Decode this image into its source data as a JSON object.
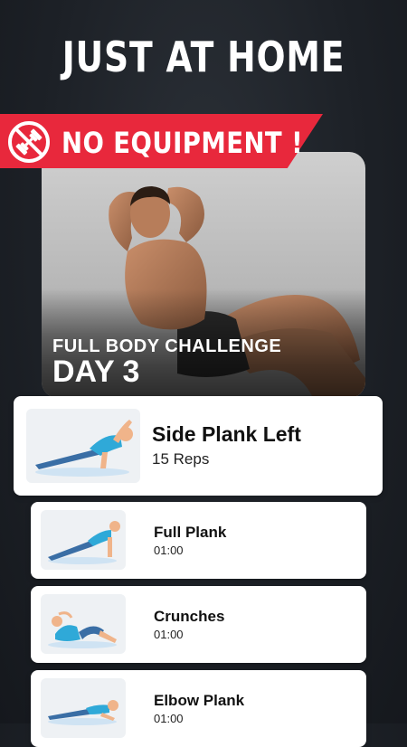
{
  "headline": "JUST AT HOME",
  "ribbon": {
    "text": "NO EQUIPMENT !",
    "icon": "no-dumbbell-icon",
    "color": "#e8283c"
  },
  "hero": {
    "subtitle": "FULL BODY CHALLENGE",
    "title": "DAY 3"
  },
  "exercises": [
    {
      "name": "Side Plank Left",
      "detail": "15 Reps",
      "icon": "side-plank-figure"
    },
    {
      "name": "Full Plank",
      "detail": "01:00",
      "icon": "full-plank-figure"
    },
    {
      "name": "Crunches",
      "detail": "01:00",
      "icon": "crunches-figure"
    },
    {
      "name": "Elbow Plank",
      "detail": "01:00",
      "icon": "elbow-plank-figure"
    }
  ]
}
